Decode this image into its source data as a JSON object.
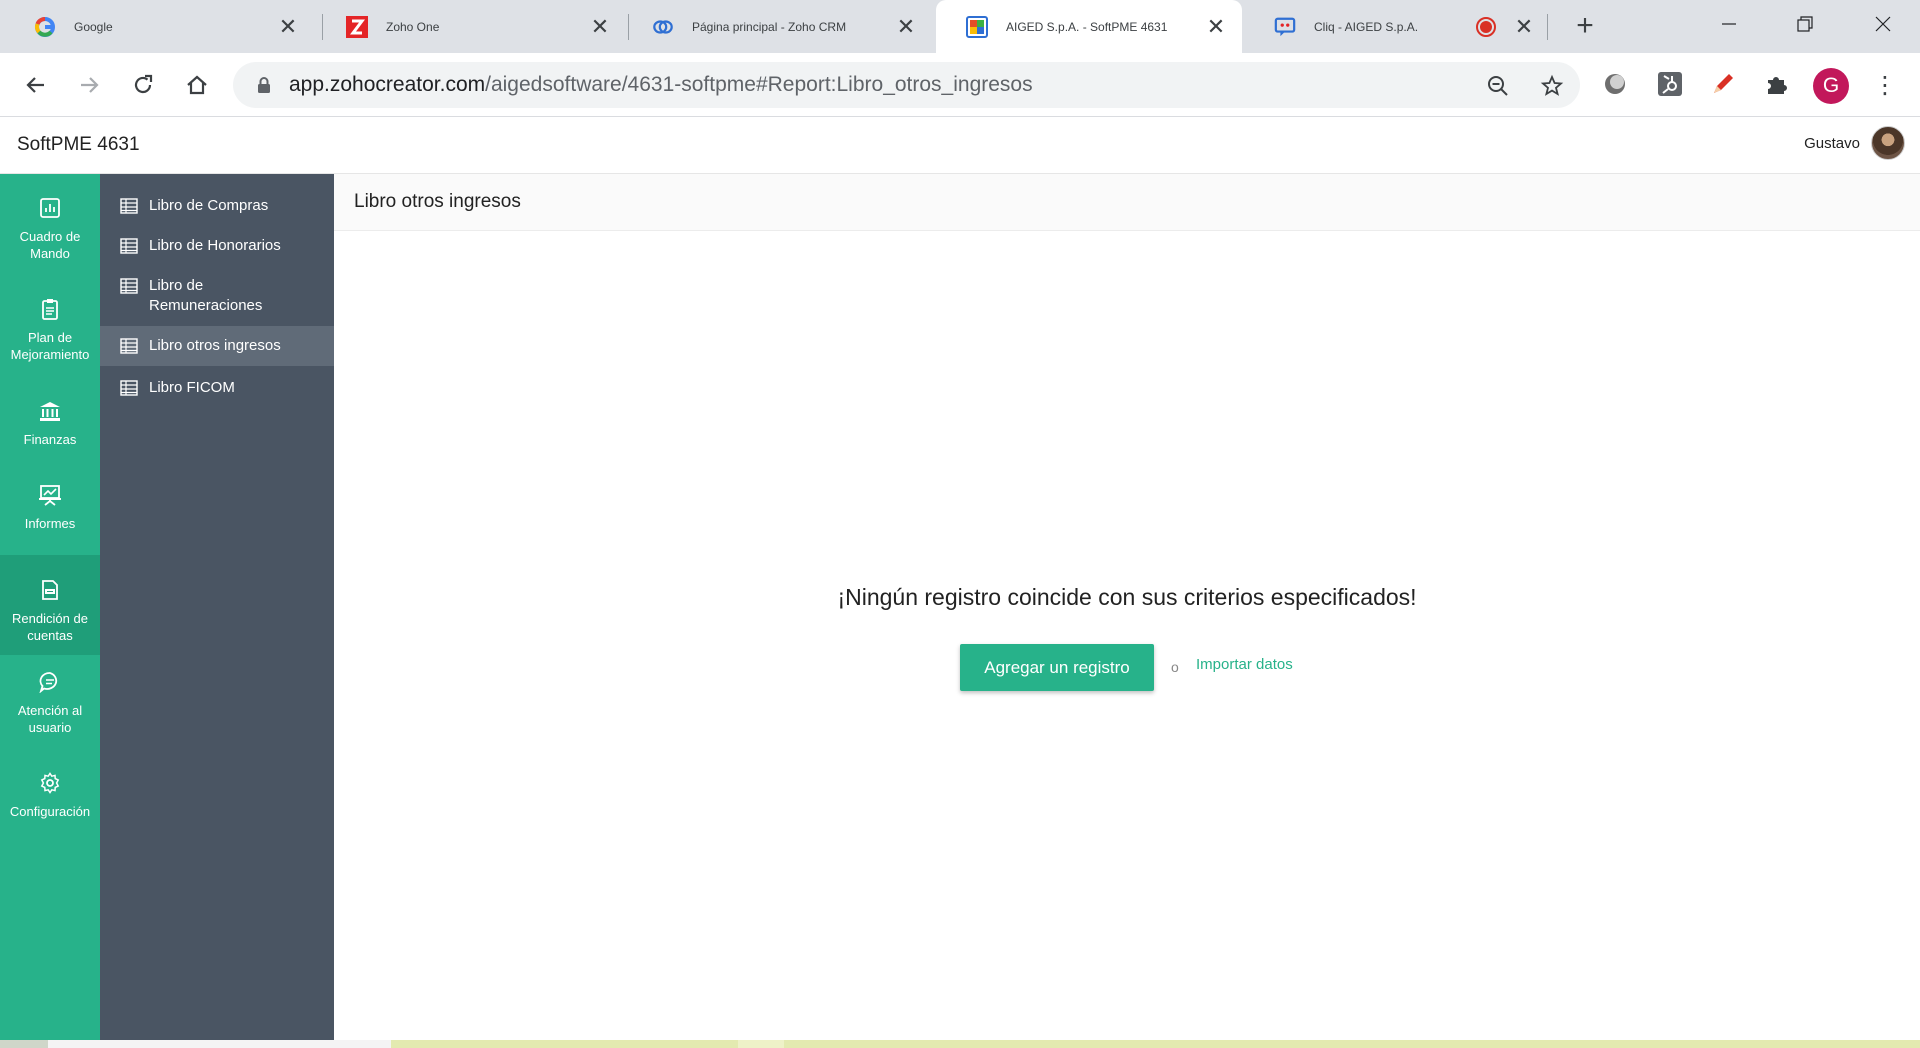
{
  "browser": {
    "tabs": [
      {
        "title": "Google",
        "favicon": "google-icon"
      },
      {
        "title": "Zoho One",
        "favicon": "zoho-one-icon"
      },
      {
        "title": "Página principal - Zoho CRM",
        "favicon": "zoho-crm-icon"
      },
      {
        "title": "AIGED S.p.A. - SoftPME 4631",
        "favicon": "zoho-creator-icon",
        "active": true
      },
      {
        "title": "Cliq - AIGED S.p.A.",
        "favicon": "zoho-cliq-icon",
        "recording": true
      }
    ],
    "url_host": "app.zohocreator.com",
    "url_path": "/aigedsoftware/4631-softpme#Report:Libro_otros_ingresos",
    "profile_initial": "G"
  },
  "app": {
    "title": "SoftPME 4631",
    "user_name": "Gustavo",
    "accent_color": "#27b28a",
    "left_nav": [
      {
        "label": "Cuadro de Mando",
        "icon": "dashboard-icon"
      },
      {
        "label": "Plan de Mejoramiento",
        "icon": "clipboard-icon"
      },
      {
        "label": "Finanzas",
        "icon": "bank-icon"
      },
      {
        "label": "Informes",
        "icon": "presentation-icon"
      },
      {
        "label": "Rendición de cuentas",
        "icon": "csv-file-icon",
        "active": true
      },
      {
        "label": "Atención al usuario",
        "icon": "chat-icon"
      },
      {
        "label": "Configuración",
        "icon": "gear-icon"
      }
    ],
    "sub_nav": [
      {
        "label": "Libro de Compras"
      },
      {
        "label": "Libro de Honorarios"
      },
      {
        "label": "Libro de Remuneraciones"
      },
      {
        "label": "Libro otros ingresos",
        "active": true
      },
      {
        "label": "Libro FICOM"
      }
    ]
  },
  "report": {
    "title": "Libro otros ingresos",
    "empty_message": "¡Ningún registro coincide con sus criterios especificados!",
    "add_button": "Agregar un registro",
    "or_text": "o",
    "import_link": "Importar datos"
  }
}
